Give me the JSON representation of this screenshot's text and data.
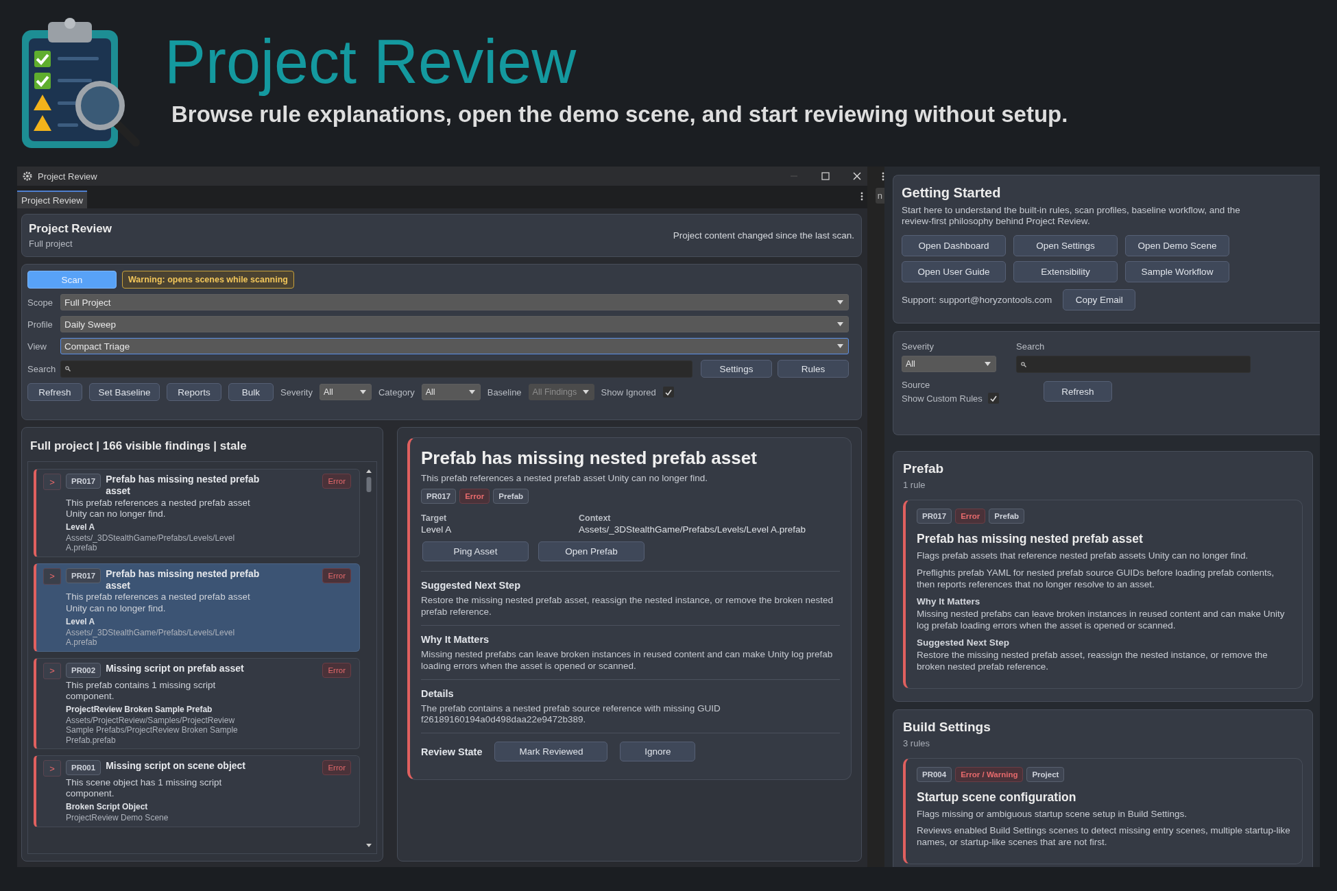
{
  "header": {
    "title": "Project Review",
    "subtitle": "Browse rule explanations, open the demo scene, and start reviewing without setup."
  },
  "window": {
    "title": "Project Review",
    "tabs": [
      {
        "label": "Project Review",
        "selected": true
      }
    ],
    "summary": {
      "title": "Project Review",
      "subtitle": "Full project",
      "status": "Project content changed since the last scan."
    },
    "scan_button": "Scan",
    "warning": "Warning: opens scenes while scanning",
    "selects": [
      {
        "label": "Scope",
        "value": "Full Project",
        "focused": false
      },
      {
        "label": "Profile",
        "value": "Daily Sweep",
        "focused": false
      },
      {
        "label": "View",
        "value": "Compact Triage",
        "focused": true
      }
    ],
    "search_label": "Search",
    "search_buttons": [
      "Settings",
      "Rules"
    ],
    "actions": [
      "Refresh",
      "Set Baseline",
      "Reports",
      "Bulk"
    ],
    "filters": [
      {
        "label": "Severity",
        "value": "All",
        "disabled": false
      },
      {
        "label": "Category",
        "value": "All",
        "disabled": false
      },
      {
        "label": "Baseline",
        "value": "All Findings",
        "disabled": true
      }
    ],
    "show_ignored": {
      "label": "Show Ignored",
      "checked": true
    }
  },
  "findings_panel": {
    "title": "Full project | 166 visible findings | stale",
    "items": [
      {
        "toggle": ">",
        "code": "PR017",
        "title": "Prefab has missing nested prefab asset",
        "severity": "Error",
        "description": "This prefab references a nested prefab asset Unity can no longer find.",
        "target": "Level A",
        "path": "Assets/_3DStealthGame/Prefabs/Levels/Level A.prefab",
        "selected": false
      },
      {
        "toggle": ">",
        "code": "PR017",
        "title": "Prefab has missing nested prefab asset",
        "severity": "Error",
        "description": "This prefab references a nested prefab asset Unity can no longer find.",
        "target": "Level A",
        "path": "Assets/_3DStealthGame/Prefabs/Levels/Level A.prefab",
        "selected": true
      },
      {
        "toggle": ">",
        "code": "PR002",
        "title": "Missing script on prefab asset",
        "severity": "Error",
        "description": "This prefab contains 1 missing script component.",
        "target": "ProjectReview Broken Sample Prefab",
        "path": "Assets/ProjectReview/Samples/ProjectReview Sample Prefabs/ProjectReview Broken Sample Prefab.prefab",
        "selected": false
      },
      {
        "toggle": ">",
        "code": "PR001",
        "title": "Missing script on scene object",
        "severity": "Error",
        "description": "This scene object has 1 missing script component.",
        "target": "Broken Script Object",
        "path": "ProjectReview Demo Scene",
        "selected": false
      }
    ]
  },
  "detail": {
    "title": "Prefab has missing nested prefab asset",
    "description": "This prefab references a nested prefab asset Unity can no longer find.",
    "tags": [
      {
        "kind": "code",
        "text": "PR017"
      },
      {
        "kind": "severity",
        "text": "Error"
      },
      {
        "kind": "category",
        "text": "Prefab"
      }
    ],
    "fields": [
      {
        "label": "Target",
        "value": "Level A"
      },
      {
        "label": "Context",
        "value": "Assets/_3DStealthGame/Prefabs/Levels/Level A.prefab"
      }
    ],
    "buttons": [
      "Ping Asset",
      "Open Prefab"
    ],
    "sections": [
      {
        "heading": "Suggested Next Step",
        "text": "Restore the missing nested prefab asset, reassign the nested instance, or remove the broken nested prefab reference."
      },
      {
        "heading": "Why It Matters",
        "text": "Missing nested prefabs can leave broken instances in reused content and can make Unity log prefab loading errors when the asset is opened or scanned."
      },
      {
        "heading": "Details",
        "text": "The prefab contains a nested prefab source reference with missing GUID f26189160194a0d498daa22e9472b389."
      }
    ],
    "review_label": "Review State",
    "review_buttons": [
      "Mark Reviewed",
      "Ignore"
    ]
  },
  "peek_tab": "n",
  "getting_started": {
    "title": "Getting Started",
    "description": "Start here to understand the built-in rules, scan profiles, baseline workflow, and the review-first philosophy behind Project Review.",
    "buttons": [
      "Open Dashboard",
      "Open Settings",
      "Open Demo Scene",
      "Open User Guide",
      "Extensibility",
      "Sample Workflow"
    ],
    "support": "Support: support@horyzontools.com",
    "copy_button": "Copy Email"
  },
  "rule_filters": {
    "severity_label": "Severity",
    "severity": "All",
    "search_label": "Search",
    "source_label": "Source",
    "show_custom_rules": {
      "label": "Show Custom Rules",
      "checked": true
    },
    "refresh": "Refresh"
  },
  "rule_groups": [
    {
      "title": "Prefab",
      "count": "1 rule",
      "rules": [
        {
          "tags": [
            {
              "kind": "code",
              "text": "PR017"
            },
            {
              "kind": "severity",
              "text": "Error"
            },
            {
              "kind": "category",
              "text": "Prefab"
            }
          ],
          "title": "Prefab has missing nested prefab asset",
          "summary": "Flags prefab assets that reference nested prefab assets Unity can no longer find.",
          "description": "Preflights prefab YAML for nested prefab source GUIDs before loading prefab contents, then reports references that no longer resolve to an asset.",
          "sections": [
            {
              "heading": "Why It Matters",
              "text": "Missing nested prefabs can leave broken instances in reused content and can make Unity log prefab loading errors when the asset is opened or scanned."
            },
            {
              "heading": "Suggested Next Step",
              "text": "Restore the missing nested prefab asset, reassign the nested instance, or remove the broken nested prefab reference."
            }
          ]
        }
      ]
    },
    {
      "title": "Build Settings",
      "count": "3 rules",
      "rules": [
        {
          "tags": [
            {
              "kind": "code",
              "text": "PR004"
            },
            {
              "kind": "severity",
              "text": "Error / Warning"
            },
            {
              "kind": "category",
              "text": "Project"
            }
          ],
          "title": "Startup scene configuration",
          "summary": "Flags missing or ambiguous startup scene setup in Build Settings.",
          "description": "Reviews enabled Build Settings scenes to detect missing entry scenes, multiple startup-like names, or startup-like scenes that are not first."
        }
      ]
    }
  ]
}
